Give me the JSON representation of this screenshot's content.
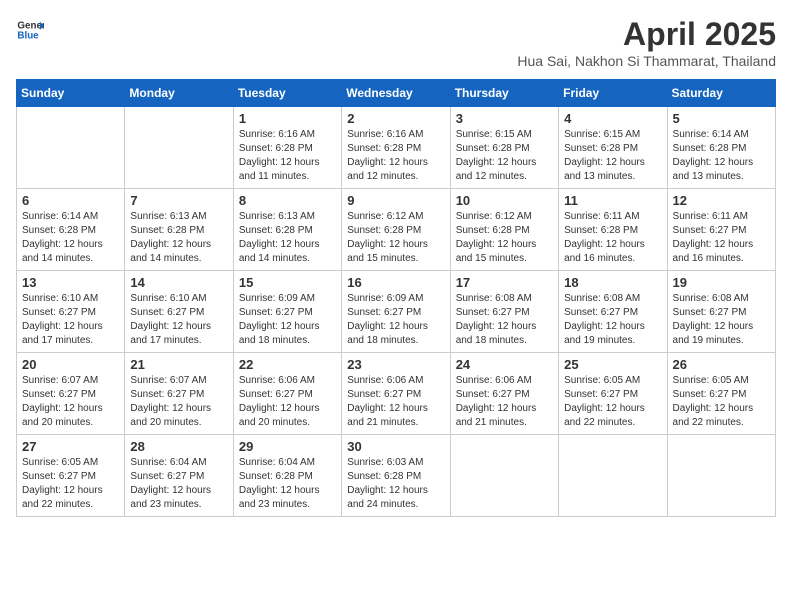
{
  "header": {
    "logo_general": "General",
    "logo_blue": "Blue",
    "month": "April 2025",
    "location": "Hua Sai, Nakhon Si Thammarat, Thailand"
  },
  "days_of_week": [
    "Sunday",
    "Monday",
    "Tuesday",
    "Wednesday",
    "Thursday",
    "Friday",
    "Saturday"
  ],
  "weeks": [
    [
      {
        "day": "",
        "info": ""
      },
      {
        "day": "",
        "info": ""
      },
      {
        "day": "1",
        "info": "Sunrise: 6:16 AM\nSunset: 6:28 PM\nDaylight: 12 hours and 11 minutes."
      },
      {
        "day": "2",
        "info": "Sunrise: 6:16 AM\nSunset: 6:28 PM\nDaylight: 12 hours and 12 minutes."
      },
      {
        "day": "3",
        "info": "Sunrise: 6:15 AM\nSunset: 6:28 PM\nDaylight: 12 hours and 12 minutes."
      },
      {
        "day": "4",
        "info": "Sunrise: 6:15 AM\nSunset: 6:28 PM\nDaylight: 12 hours and 13 minutes."
      },
      {
        "day": "5",
        "info": "Sunrise: 6:14 AM\nSunset: 6:28 PM\nDaylight: 12 hours and 13 minutes."
      }
    ],
    [
      {
        "day": "6",
        "info": "Sunrise: 6:14 AM\nSunset: 6:28 PM\nDaylight: 12 hours and 14 minutes."
      },
      {
        "day": "7",
        "info": "Sunrise: 6:13 AM\nSunset: 6:28 PM\nDaylight: 12 hours and 14 minutes."
      },
      {
        "day": "8",
        "info": "Sunrise: 6:13 AM\nSunset: 6:28 PM\nDaylight: 12 hours and 14 minutes."
      },
      {
        "day": "9",
        "info": "Sunrise: 6:12 AM\nSunset: 6:28 PM\nDaylight: 12 hours and 15 minutes."
      },
      {
        "day": "10",
        "info": "Sunrise: 6:12 AM\nSunset: 6:28 PM\nDaylight: 12 hours and 15 minutes."
      },
      {
        "day": "11",
        "info": "Sunrise: 6:11 AM\nSunset: 6:28 PM\nDaylight: 12 hours and 16 minutes."
      },
      {
        "day": "12",
        "info": "Sunrise: 6:11 AM\nSunset: 6:27 PM\nDaylight: 12 hours and 16 minutes."
      }
    ],
    [
      {
        "day": "13",
        "info": "Sunrise: 6:10 AM\nSunset: 6:27 PM\nDaylight: 12 hours and 17 minutes."
      },
      {
        "day": "14",
        "info": "Sunrise: 6:10 AM\nSunset: 6:27 PM\nDaylight: 12 hours and 17 minutes."
      },
      {
        "day": "15",
        "info": "Sunrise: 6:09 AM\nSunset: 6:27 PM\nDaylight: 12 hours and 18 minutes."
      },
      {
        "day": "16",
        "info": "Sunrise: 6:09 AM\nSunset: 6:27 PM\nDaylight: 12 hours and 18 minutes."
      },
      {
        "day": "17",
        "info": "Sunrise: 6:08 AM\nSunset: 6:27 PM\nDaylight: 12 hours and 18 minutes."
      },
      {
        "day": "18",
        "info": "Sunrise: 6:08 AM\nSunset: 6:27 PM\nDaylight: 12 hours and 19 minutes."
      },
      {
        "day": "19",
        "info": "Sunrise: 6:08 AM\nSunset: 6:27 PM\nDaylight: 12 hours and 19 minutes."
      }
    ],
    [
      {
        "day": "20",
        "info": "Sunrise: 6:07 AM\nSunset: 6:27 PM\nDaylight: 12 hours and 20 minutes."
      },
      {
        "day": "21",
        "info": "Sunrise: 6:07 AM\nSunset: 6:27 PM\nDaylight: 12 hours and 20 minutes."
      },
      {
        "day": "22",
        "info": "Sunrise: 6:06 AM\nSunset: 6:27 PM\nDaylight: 12 hours and 20 minutes."
      },
      {
        "day": "23",
        "info": "Sunrise: 6:06 AM\nSunset: 6:27 PM\nDaylight: 12 hours and 21 minutes."
      },
      {
        "day": "24",
        "info": "Sunrise: 6:06 AM\nSunset: 6:27 PM\nDaylight: 12 hours and 21 minutes."
      },
      {
        "day": "25",
        "info": "Sunrise: 6:05 AM\nSunset: 6:27 PM\nDaylight: 12 hours and 22 minutes."
      },
      {
        "day": "26",
        "info": "Sunrise: 6:05 AM\nSunset: 6:27 PM\nDaylight: 12 hours and 22 minutes."
      }
    ],
    [
      {
        "day": "27",
        "info": "Sunrise: 6:05 AM\nSunset: 6:27 PM\nDaylight: 12 hours and 22 minutes."
      },
      {
        "day": "28",
        "info": "Sunrise: 6:04 AM\nSunset: 6:27 PM\nDaylight: 12 hours and 23 minutes."
      },
      {
        "day": "29",
        "info": "Sunrise: 6:04 AM\nSunset: 6:28 PM\nDaylight: 12 hours and 23 minutes."
      },
      {
        "day": "30",
        "info": "Sunrise: 6:03 AM\nSunset: 6:28 PM\nDaylight: 12 hours and 24 minutes."
      },
      {
        "day": "",
        "info": ""
      },
      {
        "day": "",
        "info": ""
      },
      {
        "day": "",
        "info": ""
      }
    ]
  ]
}
